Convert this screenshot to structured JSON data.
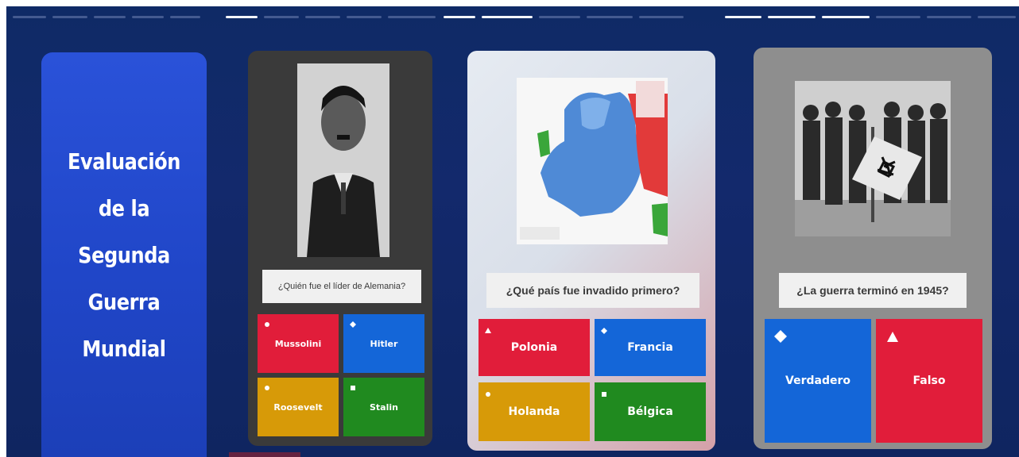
{
  "title_card": {
    "title": "Evaluación de la Segunda Guerra Mundial"
  },
  "cards": [
    {
      "question": "¿Quién fue el líder de Alemania?",
      "answers": [
        {
          "label": "Mussolini",
          "color": "#e11d3a",
          "marker": "circle"
        },
        {
          "label": "Hitler",
          "color": "#1466d8",
          "marker": "diamond"
        },
        {
          "label": "Roosevelt",
          "color": "#d79a08",
          "marker": "circle"
        },
        {
          "label": "Stalin",
          "color": "#208a1f",
          "marker": "square"
        }
      ]
    },
    {
      "question": "¿Qué país fue invadido primero?",
      "answers": [
        {
          "label": "Polonia",
          "color": "#e11d3a",
          "marker": "triangle"
        },
        {
          "label": "Francia",
          "color": "#1466d8",
          "marker": "diamond"
        },
        {
          "label": "Holanda",
          "color": "#d79a08",
          "marker": "circle"
        },
        {
          "label": "Bélgica",
          "color": "#208a1f",
          "marker": "square"
        }
      ]
    },
    {
      "question": "¿La guerra terminó en 1945?",
      "answers": [
        {
          "label": "Verdadero",
          "color": "#1466d8",
          "marker": "diamond"
        },
        {
          "label": "Falso",
          "color": "#e11d3a",
          "marker": "triangle"
        }
      ]
    }
  ],
  "icons": {
    "circle": "circle-icon",
    "diamond": "diamond-icon",
    "triangle": "triangle-icon",
    "square": "square-icon"
  }
}
